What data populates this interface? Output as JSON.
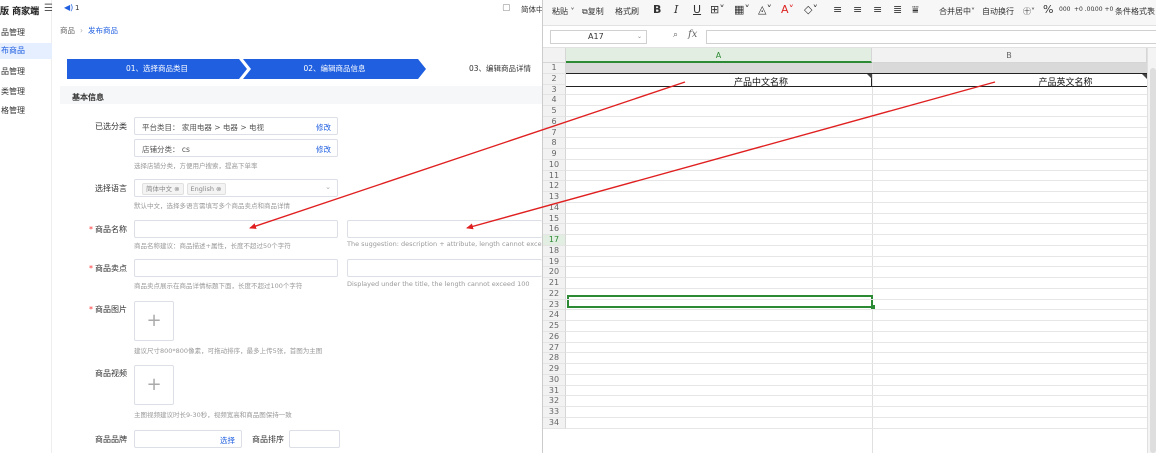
{
  "app": {
    "brand": "版 商家端",
    "notification_count": "1",
    "language": "简体中"
  },
  "sidebar": {
    "items": [
      {
        "label": "品管理",
        "active": false
      },
      {
        "label": "布商品",
        "active": true
      },
      {
        "label": "品管理",
        "active": false
      },
      {
        "label": "类管理",
        "active": false
      },
      {
        "label": "格管理",
        "active": false
      }
    ]
  },
  "breadcrumb": {
    "root": "商品",
    "current": "发布商品"
  },
  "steps": {
    "step1": "01、选择商品类目",
    "step2": "02、编辑商品信息",
    "step3": "03、编辑商品详情"
  },
  "form": {
    "section_title": "基本信息",
    "category": {
      "label": "已选分类",
      "platform": "平台类目： 家用电器 > 电器 > 电视",
      "platform_action": "修改",
      "store": "店铺分类： cs",
      "store_action": "修改",
      "hint": "选择店铺分类，方便用户搜索，提高下单率"
    },
    "language": {
      "label": "选择语言",
      "tags": [
        "简体中文 ⊗",
        "English ⊗"
      ],
      "hint": "默认中文，选择多语言需填写多个商品卖点和商品详情"
    },
    "product_name": {
      "label": "商品名称",
      "hint_cn": "商品名称建议：商品描述+属性，长度不超过50个字符",
      "hint_en": "The suggestion: description + attribute, length cannot exceed 50"
    },
    "selling_point": {
      "label": "商品卖点",
      "hint_cn": "商品卖点展示在商品详情标题下面，长度不超过100个字符",
      "hint_en": "Displayed under the title, the length cannot exceed 100"
    },
    "images": {
      "label": "商品图片",
      "plus": "+",
      "hint": "建议尺寸800*800像素，可拖动排序，最多上传5张，首图为主图"
    },
    "video": {
      "label": "商品视频",
      "plus": "+",
      "hint": "主图视频建议时长9-30秒，视频宽高和商品图保持一致"
    },
    "brand": {
      "label": "商品品牌",
      "action": "选择"
    },
    "sort": {
      "label": "商品排序"
    }
  },
  "spreadsheet": {
    "ribbon": {
      "paste": "粘贴",
      "copy": "复制",
      "format_painter": "格式刷",
      "bold": "B",
      "italic": "I",
      "underline": "U",
      "merge": "合并居中",
      "wrap": "自动换行",
      "percent": "%",
      "thousands": "000",
      "inc_decimal": "+0 .00",
      "dec_decimal": ".00 +0",
      "cond_format": "条件格式",
      "table_style": "表"
    },
    "cell_ref": "A17",
    "fx": "fx",
    "columns": [
      "A",
      "B"
    ],
    "rows": [
      "1",
      "2",
      "3",
      "4",
      "5",
      "6",
      "7",
      "8",
      "9",
      "10",
      "11",
      "12",
      "13",
      "14",
      "15",
      "16",
      "17",
      "18",
      "19",
      "20",
      "21",
      "22",
      "23",
      "24",
      "25",
      "26",
      "27",
      "28",
      "29",
      "30",
      "31",
      "32",
      "33",
      "34"
    ],
    "selected_row": "17",
    "header_cells": {
      "A2": "产品中文名称",
      "B2": "产品英文名称"
    }
  },
  "colors": {
    "primary": "#1f5fe0",
    "arrow": "#e02020",
    "sheet_accent": "#2d8a34"
  }
}
